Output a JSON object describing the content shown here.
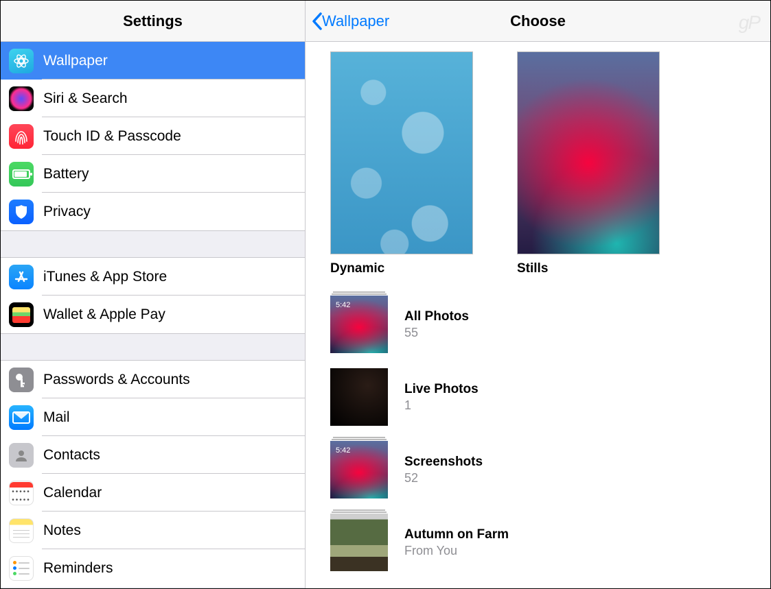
{
  "sidebar": {
    "title": "Settings",
    "groups": [
      [
        {
          "id": "wallpaper",
          "label": "Wallpaper",
          "active": true
        },
        {
          "id": "siri",
          "label": "Siri & Search"
        },
        {
          "id": "touchid",
          "label": "Touch ID & Passcode"
        },
        {
          "id": "battery",
          "label": "Battery"
        },
        {
          "id": "privacy",
          "label": "Privacy"
        }
      ],
      [
        {
          "id": "appstore",
          "label": "iTunes & App Store"
        },
        {
          "id": "wallet",
          "label": "Wallet & Apple Pay"
        }
      ],
      [
        {
          "id": "passwords",
          "label": "Passwords & Accounts"
        },
        {
          "id": "mail",
          "label": "Mail"
        },
        {
          "id": "contacts",
          "label": "Contacts"
        },
        {
          "id": "calendar",
          "label": "Calendar"
        },
        {
          "id": "notes",
          "label": "Notes"
        },
        {
          "id": "reminders",
          "label": "Reminders"
        }
      ]
    ]
  },
  "detail": {
    "back_label": "Wallpaper",
    "title": "Choose",
    "wallpapers": [
      {
        "id": "dynamic",
        "label": "Dynamic"
      },
      {
        "id": "stills",
        "label": "Stills"
      }
    ],
    "albums": [
      {
        "id": "all",
        "title": "All Photos",
        "subtitle": "55",
        "thumb": "colorful",
        "stack": true,
        "time": "5:42"
      },
      {
        "id": "live",
        "title": "Live Photos",
        "subtitle": "1",
        "thumb": "dark",
        "stack": false
      },
      {
        "id": "screenshots",
        "title": "Screenshots",
        "subtitle": "52",
        "thumb": "colorful",
        "stack": true,
        "time": "5:42"
      },
      {
        "id": "autumn",
        "title": "Autumn on Farm",
        "subtitle": "From You",
        "thumb": "photo",
        "stack": true
      }
    ]
  },
  "watermark": "gP"
}
